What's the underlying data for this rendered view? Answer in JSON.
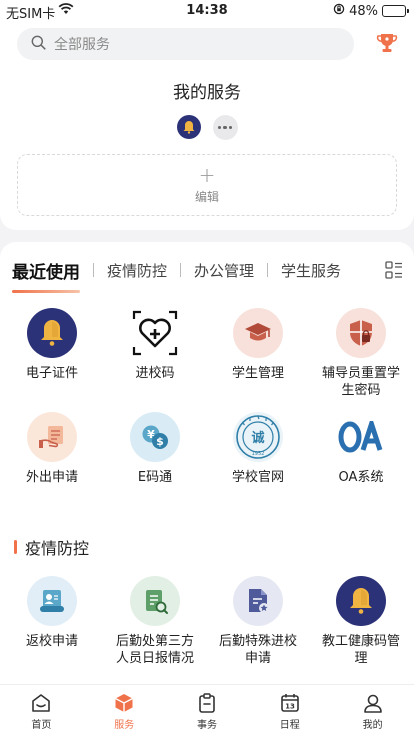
{
  "status": {
    "carrier": "无SIM卡",
    "time": "14:38",
    "battery": "48%"
  },
  "search": {
    "placeholder": "全部服务"
  },
  "my_services": {
    "title": "我的服务",
    "edit_label": "编辑"
  },
  "tabs": [
    "最近使用",
    "疫情防控",
    "办公管理",
    "学生服务"
  ],
  "recent": [
    {
      "label": "电子证件",
      "icon": "bell-icon"
    },
    {
      "label": "进校码",
      "icon": "heart-plus-icon"
    },
    {
      "label": "学生管理",
      "icon": "graduation-cap-icon"
    },
    {
      "label": "辅导员重置学生密码",
      "icon": "shield-lock-icon"
    },
    {
      "label": "外出申请",
      "icon": "hand-document-icon"
    },
    {
      "label": "E码通",
      "icon": "yen-dollar-icon"
    },
    {
      "label": "学校官网",
      "icon": "school-seal-icon"
    },
    {
      "label": "OA系统",
      "icon": "oa-logo-icon"
    }
  ],
  "epidemic": {
    "title": "疫情防控",
    "items": [
      {
        "label": "返校申请",
        "icon": "scroll-document-icon"
      },
      {
        "label": "后勤处第三方人员日报情况",
        "icon": "report-search-icon"
      },
      {
        "label": "后勤特殊进校申请",
        "icon": "file-star-icon"
      },
      {
        "label": "教工健康码管理",
        "icon": "bell-icon"
      }
    ]
  },
  "tabbar": [
    {
      "label": "首页",
      "icon": "home-icon"
    },
    {
      "label": "服务",
      "icon": "cube-icon"
    },
    {
      "label": "事务",
      "icon": "clipboard-icon"
    },
    {
      "label": "日程",
      "icon": "calendar-icon"
    },
    {
      "label": "我的",
      "icon": "person-icon"
    }
  ],
  "colors": {
    "accent": "#f0724a",
    "navy": "#2c3278",
    "bell": "#f0b442"
  }
}
